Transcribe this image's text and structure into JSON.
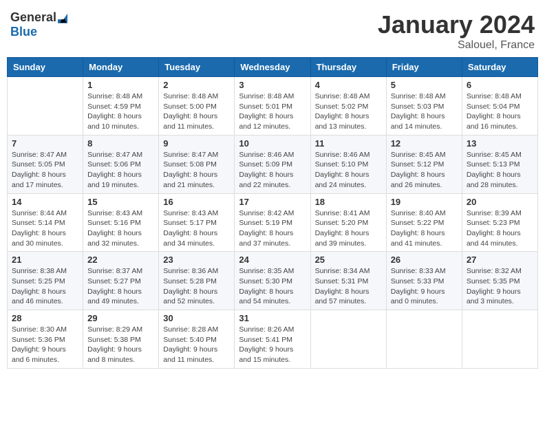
{
  "logo": {
    "general": "General",
    "blue": "Blue"
  },
  "title": "January 2024",
  "subtitle": "Salouel, France",
  "weekdays": [
    "Sunday",
    "Monday",
    "Tuesday",
    "Wednesday",
    "Thursday",
    "Friday",
    "Saturday"
  ],
  "weeks": [
    [
      null,
      {
        "day": "1",
        "sunrise": "8:48 AM",
        "sunset": "4:59 PM",
        "daylight": "8 hours and 10 minutes."
      },
      {
        "day": "2",
        "sunrise": "8:48 AM",
        "sunset": "5:00 PM",
        "daylight": "8 hours and 11 minutes."
      },
      {
        "day": "3",
        "sunrise": "8:48 AM",
        "sunset": "5:01 PM",
        "daylight": "8 hours and 12 minutes."
      },
      {
        "day": "4",
        "sunrise": "8:48 AM",
        "sunset": "5:02 PM",
        "daylight": "8 hours and 13 minutes."
      },
      {
        "day": "5",
        "sunrise": "8:48 AM",
        "sunset": "5:03 PM",
        "daylight": "8 hours and 14 minutes."
      },
      {
        "day": "6",
        "sunrise": "8:48 AM",
        "sunset": "5:04 PM",
        "daylight": "8 hours and 16 minutes."
      }
    ],
    [
      {
        "day": "7",
        "sunrise": "8:47 AM",
        "sunset": "5:05 PM",
        "daylight": "8 hours and 17 minutes."
      },
      {
        "day": "8",
        "sunrise": "8:47 AM",
        "sunset": "5:06 PM",
        "daylight": "8 hours and 19 minutes."
      },
      {
        "day": "9",
        "sunrise": "8:47 AM",
        "sunset": "5:08 PM",
        "daylight": "8 hours and 21 minutes."
      },
      {
        "day": "10",
        "sunrise": "8:46 AM",
        "sunset": "5:09 PM",
        "daylight": "8 hours and 22 minutes."
      },
      {
        "day": "11",
        "sunrise": "8:46 AM",
        "sunset": "5:10 PM",
        "daylight": "8 hours and 24 minutes."
      },
      {
        "day": "12",
        "sunrise": "8:45 AM",
        "sunset": "5:12 PM",
        "daylight": "8 hours and 26 minutes."
      },
      {
        "day": "13",
        "sunrise": "8:45 AM",
        "sunset": "5:13 PM",
        "daylight": "8 hours and 28 minutes."
      }
    ],
    [
      {
        "day": "14",
        "sunrise": "8:44 AM",
        "sunset": "5:14 PM",
        "daylight": "8 hours and 30 minutes."
      },
      {
        "day": "15",
        "sunrise": "8:43 AM",
        "sunset": "5:16 PM",
        "daylight": "8 hours and 32 minutes."
      },
      {
        "day": "16",
        "sunrise": "8:43 AM",
        "sunset": "5:17 PM",
        "daylight": "8 hours and 34 minutes."
      },
      {
        "day": "17",
        "sunrise": "8:42 AM",
        "sunset": "5:19 PM",
        "daylight": "8 hours and 37 minutes."
      },
      {
        "day": "18",
        "sunrise": "8:41 AM",
        "sunset": "5:20 PM",
        "daylight": "8 hours and 39 minutes."
      },
      {
        "day": "19",
        "sunrise": "8:40 AM",
        "sunset": "5:22 PM",
        "daylight": "8 hours and 41 minutes."
      },
      {
        "day": "20",
        "sunrise": "8:39 AM",
        "sunset": "5:23 PM",
        "daylight": "8 hours and 44 minutes."
      }
    ],
    [
      {
        "day": "21",
        "sunrise": "8:38 AM",
        "sunset": "5:25 PM",
        "daylight": "8 hours and 46 minutes."
      },
      {
        "day": "22",
        "sunrise": "8:37 AM",
        "sunset": "5:27 PM",
        "daylight": "8 hours and 49 minutes."
      },
      {
        "day": "23",
        "sunrise": "8:36 AM",
        "sunset": "5:28 PM",
        "daylight": "8 hours and 52 minutes."
      },
      {
        "day": "24",
        "sunrise": "8:35 AM",
        "sunset": "5:30 PM",
        "daylight": "8 hours and 54 minutes."
      },
      {
        "day": "25",
        "sunrise": "8:34 AM",
        "sunset": "5:31 PM",
        "daylight": "8 hours and 57 minutes."
      },
      {
        "day": "26",
        "sunrise": "8:33 AM",
        "sunset": "5:33 PM",
        "daylight": "9 hours and 0 minutes."
      },
      {
        "day": "27",
        "sunrise": "8:32 AM",
        "sunset": "5:35 PM",
        "daylight": "9 hours and 3 minutes."
      }
    ],
    [
      {
        "day": "28",
        "sunrise": "8:30 AM",
        "sunset": "5:36 PM",
        "daylight": "9 hours and 6 minutes."
      },
      {
        "day": "29",
        "sunrise": "8:29 AM",
        "sunset": "5:38 PM",
        "daylight": "9 hours and 8 minutes."
      },
      {
        "day": "30",
        "sunrise": "8:28 AM",
        "sunset": "5:40 PM",
        "daylight": "9 hours and 11 minutes."
      },
      {
        "day": "31",
        "sunrise": "8:26 AM",
        "sunset": "5:41 PM",
        "daylight": "9 hours and 15 minutes."
      },
      null,
      null,
      null
    ]
  ]
}
